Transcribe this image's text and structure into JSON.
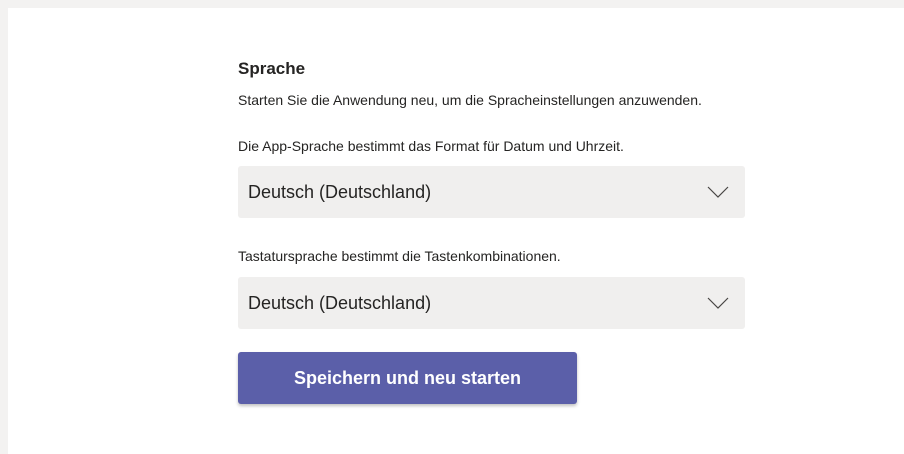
{
  "language_settings": {
    "title": "Sprache",
    "restart_notice": "Starten Sie die Anwendung neu, um die Spracheinstellungen anzuwenden.",
    "app_language": {
      "description": "Die App-Sprache bestimmt das Format für Datum und Uhrzeit.",
      "selected": "Deutsch (Deutschland)"
    },
    "keyboard_language": {
      "description": "Tastatursprache bestimmt die Tastenkombinationen.",
      "selected": "Deutsch (Deutschland)"
    },
    "save_button_label": "Speichern und neu starten"
  },
  "icons": {
    "dropdown": "chevron-down-icon"
  },
  "colors": {
    "background": "#f3f2f1",
    "panel": "#ffffff",
    "text": "#252423",
    "dropdown_bg": "#f0efee",
    "accent": "#5b5fa9"
  }
}
